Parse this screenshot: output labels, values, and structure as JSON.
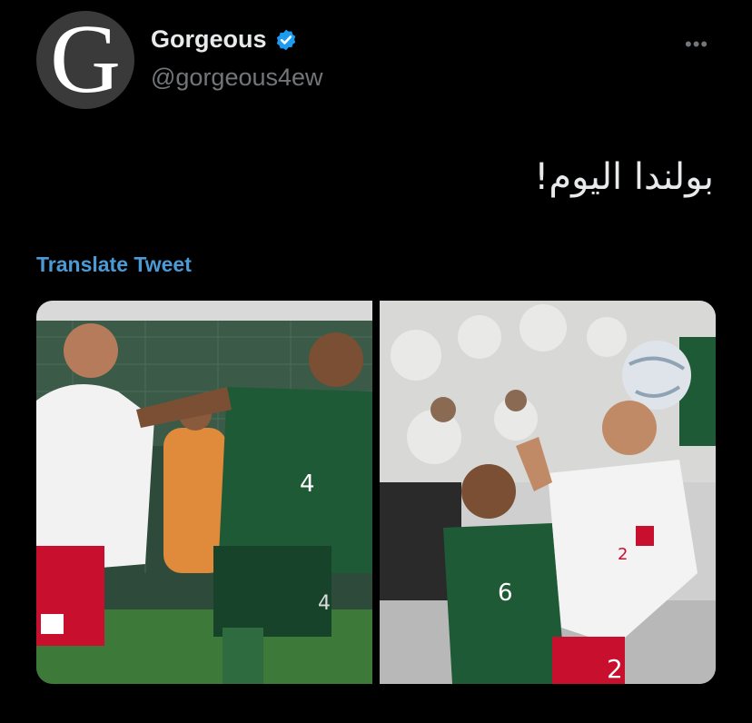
{
  "author": {
    "avatar_letter": "G",
    "display_name": "Gorgeous",
    "handle": "@gorgeous4ew",
    "verified_icon": "verified-badge-icon",
    "verified_color": "#1d9bf0"
  },
  "menu": {
    "more_label": "•••"
  },
  "tweet": {
    "text": "بولندا اليوم!",
    "translate_label": "Translate Tweet"
  },
  "media": {
    "photo1": {
      "jersey_number": "4",
      "shorts_number": "4"
    },
    "photo2": {
      "jersey_number": "6",
      "white_jersey_number": "2",
      "shorts_number": "2"
    }
  },
  "colors": {
    "background": "#000000",
    "text": "#e7e9ea",
    "muted": "#71767b",
    "link": "#4a9ad6",
    "saudi_green": "#1f5a36",
    "poland_red": "#c8102e"
  }
}
